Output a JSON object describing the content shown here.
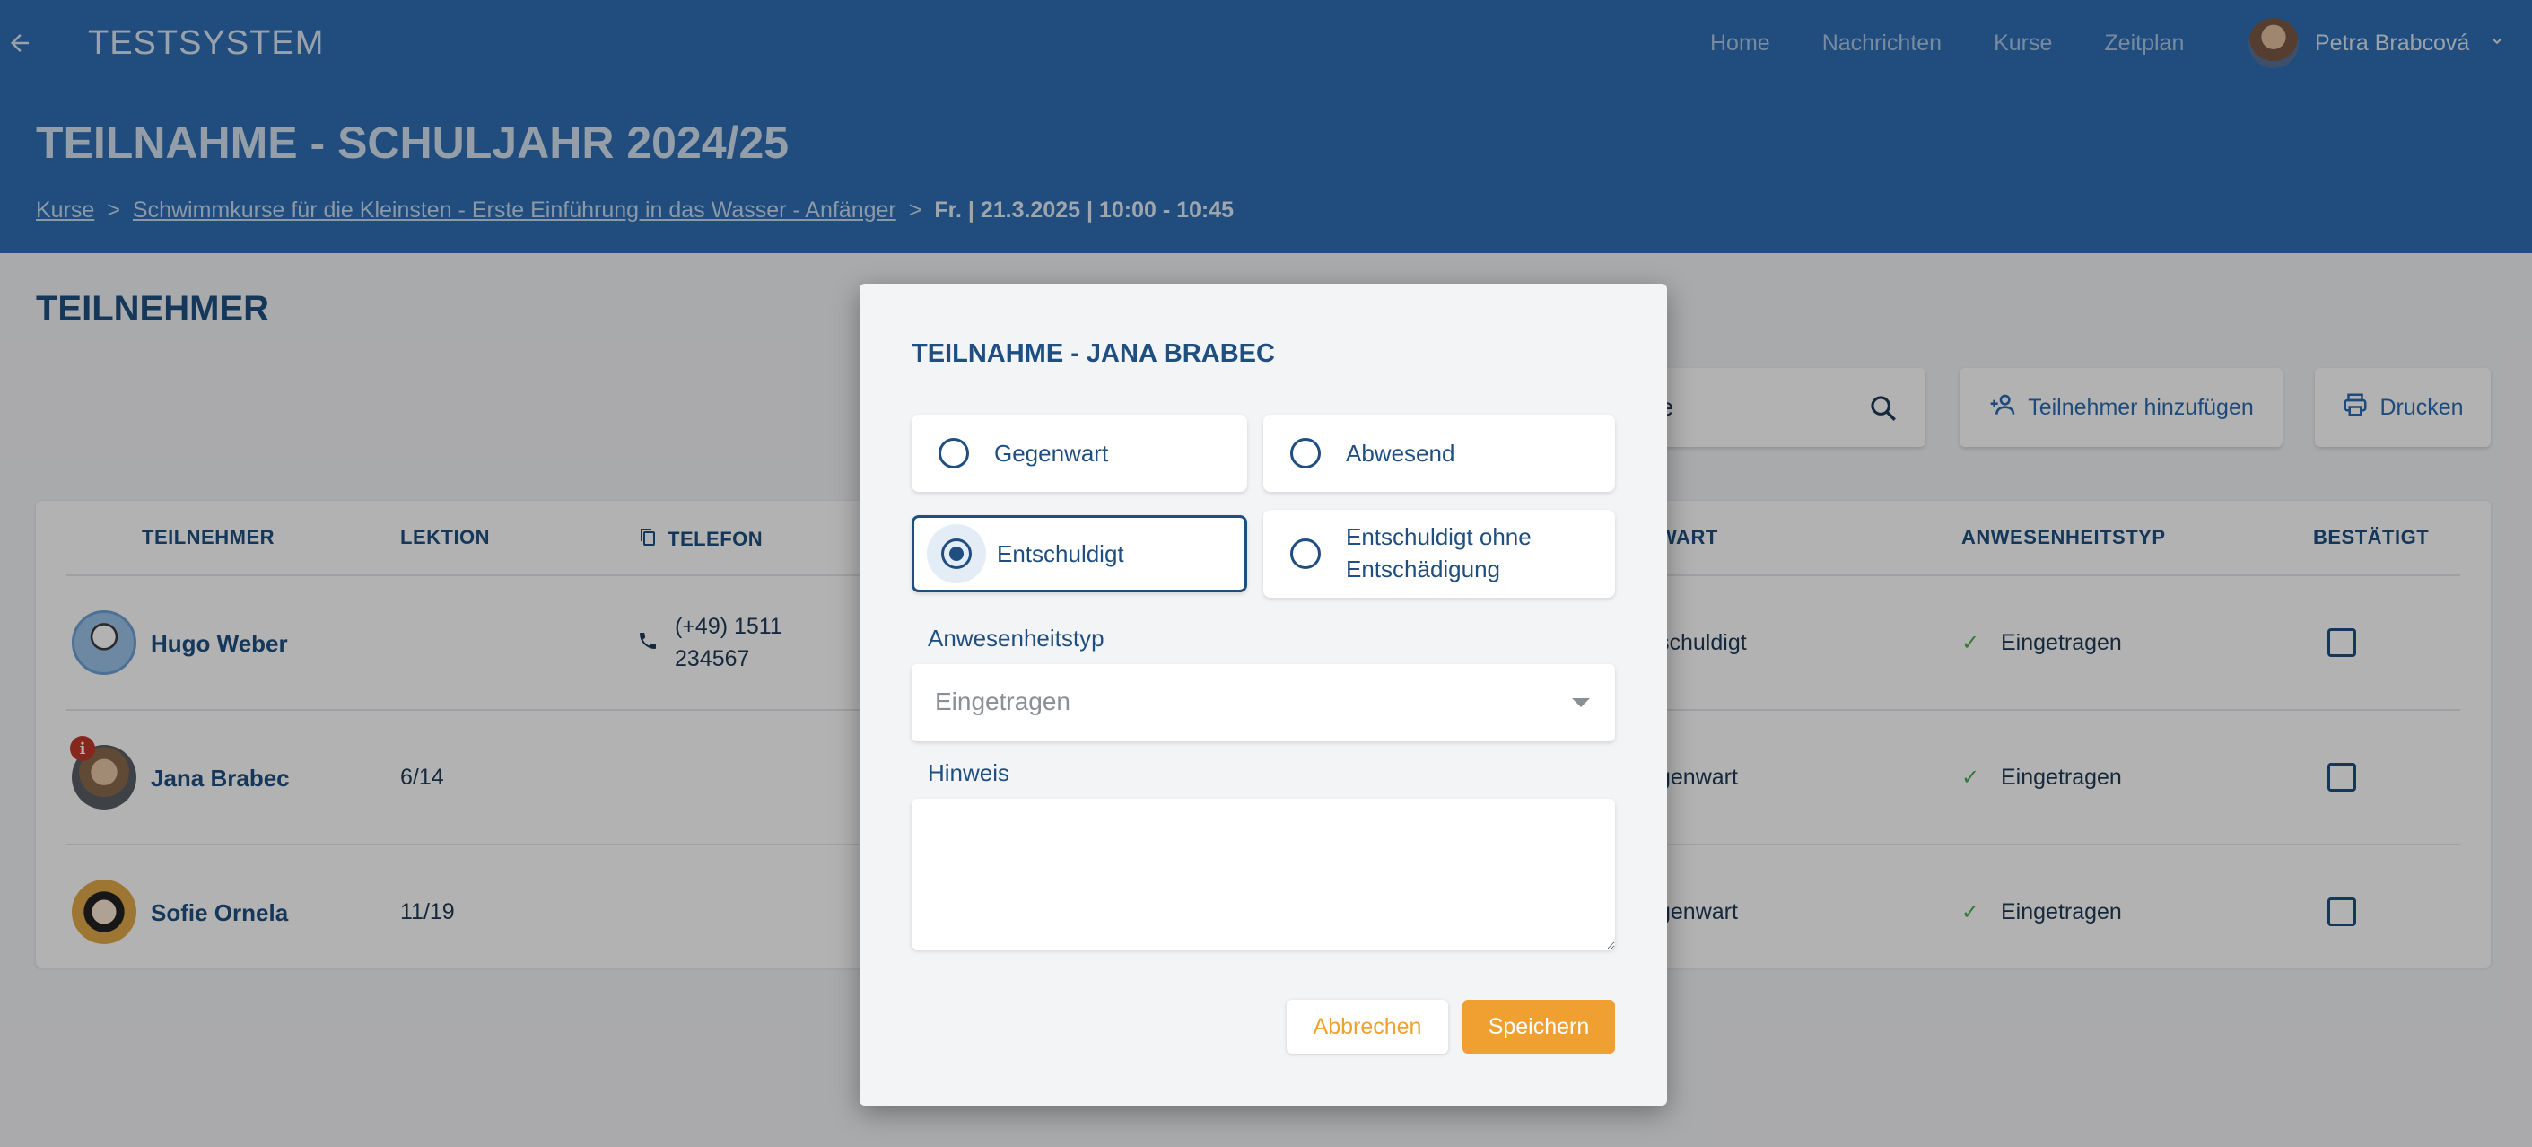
{
  "app": {
    "title": "TESTSYSTEM"
  },
  "nav": {
    "items": [
      "Home",
      "Nachrichten",
      "Kurse",
      "Zeitplan"
    ]
  },
  "user": {
    "name": "Petra Brabcová"
  },
  "page": {
    "title": "TEILNAHME - SCHULJAHR 2024/25",
    "breadcrumb": {
      "root": "Kurse",
      "course": "Schwimmkurse für die Kleinsten - Erste Einführung in das Wasser - Anfänger",
      "current": "Fr. | 21.3.2025 | 10:00 - 10:45",
      "separator": ">"
    }
  },
  "section": {
    "title": "TEILNEHMER"
  },
  "toolbar": {
    "search_placeholder": "che",
    "add_label": "Teilnehmer hinzufügen",
    "print_label": "Drucken"
  },
  "table": {
    "headers": {
      "participant": "TEILNEHMER",
      "lesson": "LEKTION",
      "phone": "TELEFON",
      "status": "WART",
      "attendance_type": "ANWESENHEITSTYP",
      "confirmed": "BESTÄTIGT"
    },
    "rows": [
      {
        "name": "Hugo Weber",
        "lesson": "",
        "phone_line1": "(+49) 1511",
        "phone_line2": "234567",
        "status": "schuldigt",
        "attendance_type": "Eingetragen"
      },
      {
        "name": "Jana Brabec",
        "lesson": "6/14",
        "phone_line1": "",
        "phone_line2": "",
        "status": "genwart",
        "attendance_type": "Eingetragen"
      },
      {
        "name": "Sofie Ornela",
        "lesson": "11/19",
        "phone_line1": "",
        "phone_line2": "",
        "status": "genwart",
        "attendance_type": "Eingetragen"
      }
    ]
  },
  "dialog": {
    "title": "TEILNAHME - JANA BRABEC",
    "options": {
      "present": "Gegenwart",
      "absent": "Abwesend",
      "excused": "Entschuldigt",
      "excused_no_comp_line1": "Entschuldigt ohne",
      "excused_no_comp_line2": "Entschädigung"
    },
    "selected_option": "Entschuldigt",
    "attendance_type_label": "Anwesenheitstyp",
    "attendance_type_value": "Eingetragen",
    "note_label": "Hinweis",
    "note_value": "",
    "cancel_label": "Abbrechen",
    "save_label": "Speichern"
  },
  "colors": {
    "primary": "#2f6fb5",
    "accent": "#f0a030",
    "text": "#1f4f80"
  }
}
